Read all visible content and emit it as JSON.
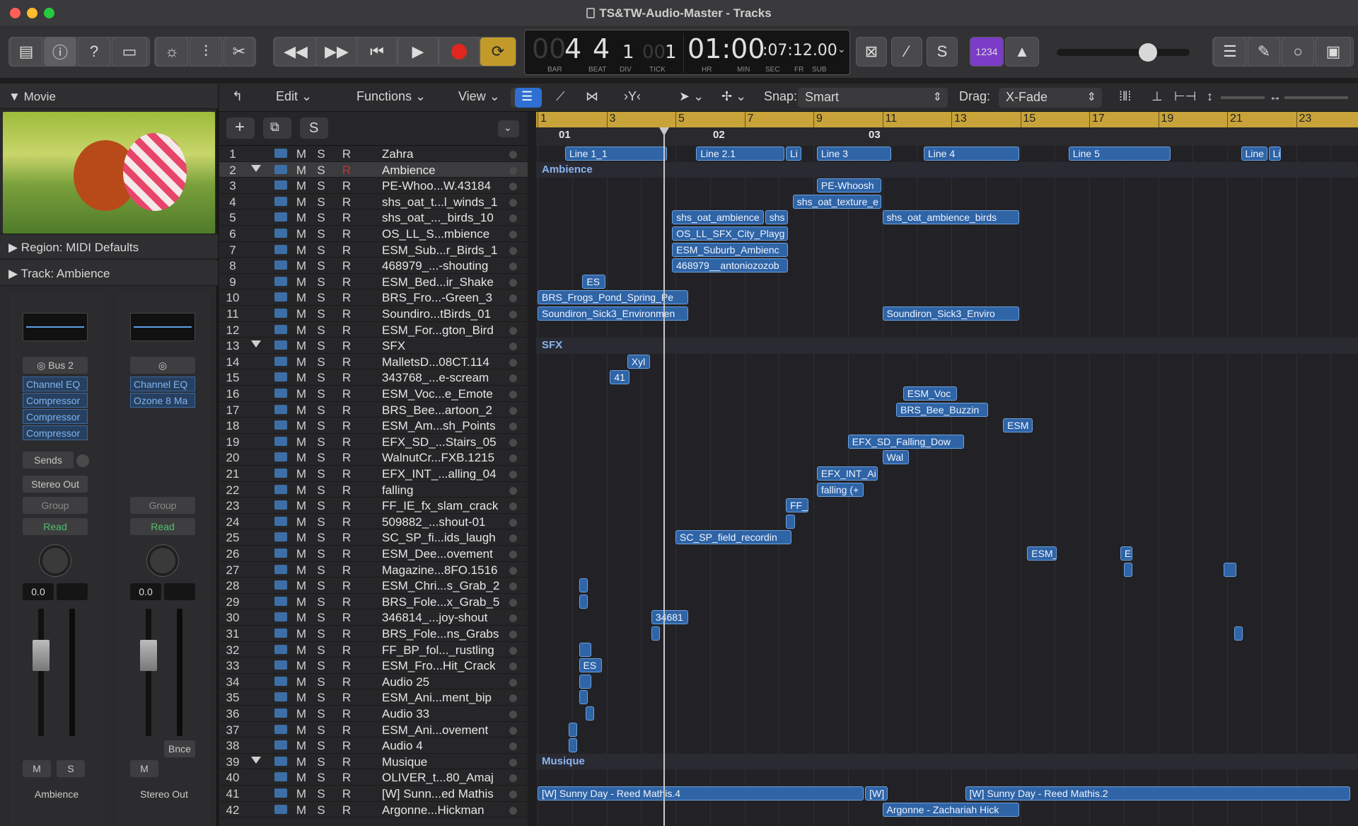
{
  "window": {
    "title": "TS&TW-Audio-Master - Tracks"
  },
  "lcd": {
    "bar": "4",
    "bar_ghost": "00",
    "beat": "4",
    "div": "1",
    "tick": "1",
    "tick_ghost": "00",
    "time_main": "01:00",
    "time_sub": ":07:12.00",
    "labels": [
      "BAR",
      "BEAT",
      "DIV",
      "TICK",
      "HR",
      "MIN",
      "SEC",
      "FR",
      "SUB"
    ]
  },
  "toolbar": {
    "count_in": "1234"
  },
  "inspector": {
    "movie_label": "Movie",
    "region_label": "Region:",
    "region_value": "MIDI Defaults",
    "track_label": "Track:",
    "track_value": "Ambience",
    "strip1": {
      "bus": "Bus 2",
      "plugins": [
        "Channel EQ",
        "Compressor",
        "Compressor",
        "Compressor"
      ],
      "sends": "Sends",
      "output": "Stereo Out",
      "group": "Group",
      "auto": "Read",
      "volume": "0.0",
      "mute": "M",
      "solo": "S",
      "name": "Ambience"
    },
    "strip2": {
      "plugins": [
        "Channel EQ",
        "Ozone 8 Ma"
      ],
      "group": "Group",
      "auto": "Read",
      "volume": "0.0",
      "bounce": "Bnce",
      "mute": "M",
      "name": "Stereo Out"
    },
    "scale": [
      "0",
      "3",
      "6",
      "9",
      "12",
      "15",
      "18",
      "21",
      "24",
      "30",
      "35",
      "40",
      "45",
      "50",
      "60"
    ]
  },
  "localbar": {
    "edit": "Edit",
    "functions": "Functions",
    "view": "View",
    "snap_label": "Snap:",
    "snap_value": "Smart",
    "drag_label": "Drag:",
    "drag_value": "X-Fade"
  },
  "header": {
    "add": "+",
    "s": "S"
  },
  "ruler": {
    "bars": [
      "1",
      "3",
      "5",
      "7",
      "9",
      "11",
      "13",
      "15",
      "17",
      "19",
      "21",
      "23"
    ],
    "markers": [
      "01",
      "02",
      "03"
    ]
  },
  "tracks": [
    {
      "n": "1",
      "name": "Zahra"
    },
    {
      "n": "2",
      "name": "Ambience",
      "folder": true
    },
    {
      "n": "3",
      "name": "PE-Whoo...W.43184"
    },
    {
      "n": "4",
      "name": "shs_oat_t...l_winds_1"
    },
    {
      "n": "5",
      "name": "shs_oat_..._birds_10"
    },
    {
      "n": "6",
      "name": "OS_LL_S...mbience"
    },
    {
      "n": "7",
      "name": "ESM_Sub...r_Birds_1"
    },
    {
      "n": "8",
      "name": "468979_...-shouting"
    },
    {
      "n": "9",
      "name": "ESM_Bed...ir_Shake"
    },
    {
      "n": "10",
      "name": "BRS_Fro...-Green_3"
    },
    {
      "n": "11",
      "name": "Soundiro...tBirds_01"
    },
    {
      "n": "12",
      "name": "ESM_For...gton_Bird"
    },
    {
      "n": "13",
      "name": "SFX",
      "folder": true
    },
    {
      "n": "14",
      "name": "MalletsD...08CT.114"
    },
    {
      "n": "15",
      "name": "343768_...e-scream"
    },
    {
      "n": "16",
      "name": "ESM_Voc...e_Emote"
    },
    {
      "n": "17",
      "name": "BRS_Bee...artoon_2"
    },
    {
      "n": "18",
      "name": "ESM_Am...sh_Points"
    },
    {
      "n": "19",
      "name": "EFX_SD_...Stairs_05"
    },
    {
      "n": "20",
      "name": "WalnutCr...FXB.1215"
    },
    {
      "n": "21",
      "name": "EFX_INT_...alling_04"
    },
    {
      "n": "22",
      "name": "falling"
    },
    {
      "n": "23",
      "name": "FF_IE_fx_slam_crack"
    },
    {
      "n": "24",
      "name": "509882_...shout-01"
    },
    {
      "n": "25",
      "name": "SC_SP_fi...ids_laugh"
    },
    {
      "n": "26",
      "name": "ESM_Dee...ovement"
    },
    {
      "n": "27",
      "name": "Magazine...8FO.1516"
    },
    {
      "n": "28",
      "name": "ESM_Chri...s_Grab_2"
    },
    {
      "n": "29",
      "name": "BRS_Fole...x_Grab_5"
    },
    {
      "n": "30",
      "name": "346814_...joy-shout"
    },
    {
      "n": "31",
      "name": "BRS_Fole...ns_Grabs"
    },
    {
      "n": "32",
      "name": "FF_BP_fol..._rustling"
    },
    {
      "n": "33",
      "name": "ESM_Fro...Hit_Crack"
    },
    {
      "n": "34",
      "name": "Audio 25"
    },
    {
      "n": "35",
      "name": "ESM_Ani...ment_bip"
    },
    {
      "n": "36",
      "name": "Audio 33"
    },
    {
      "n": "37",
      "name": "ESM_Ani...ovement"
    },
    {
      "n": "38",
      "name": "Audio 4"
    },
    {
      "n": "39",
      "name": "Musique",
      "folder": true
    },
    {
      "n": "40",
      "name": "OLIVER_t...80_Amaj"
    },
    {
      "n": "41",
      "name": "[W] Sunn...ed Mathis"
    },
    {
      "n": "42",
      "name": "Argonne...Hickman"
    }
  ],
  "track_buttons": {
    "m": "M",
    "s": "S",
    "r": "R"
  },
  "folders": [
    {
      "row": 1,
      "label": "Ambience"
    },
    {
      "row": 12,
      "label": "SFX"
    },
    {
      "row": 38,
      "label": "Musique"
    }
  ],
  "regions": [
    {
      "row": 0,
      "start": 0.4,
      "end": 1.9,
      "label": "Line 1_1"
    },
    {
      "row": 0,
      "start": 2.3,
      "end": 3.6,
      "label": "Line 2.1"
    },
    {
      "row": 0,
      "start": 3.6,
      "end": 3.85,
      "label": "Li"
    },
    {
      "row": 0,
      "start": 4.05,
      "end": 5.15,
      "label": "Line 3"
    },
    {
      "row": 0,
      "start": 5.6,
      "end": 7.0,
      "label": "Line 4"
    },
    {
      "row": 0,
      "start": 7.7,
      "end": 9.2,
      "label": "Line 5"
    },
    {
      "row": 0,
      "start": 10.2,
      "end": 10.6,
      "label": "Line"
    },
    {
      "row": 0,
      "start": 10.6,
      "end": 10.8,
      "label": "Li"
    },
    {
      "row": 2,
      "start": 4.05,
      "end": 5.0,
      "label": "PE-Whoosh"
    },
    {
      "row": 3,
      "start": 3.7,
      "end": 5.0,
      "label": "shs_oat_texture_e"
    },
    {
      "row": 4,
      "start": 1.95,
      "end": 3.3,
      "label": "shs_oat_ambience"
    },
    {
      "row": 4,
      "start": 3.3,
      "end": 3.65,
      "label": "shs"
    },
    {
      "row": 4,
      "start": 5.0,
      "end": 7.0,
      "label": "shs_oat_ambience_birds"
    },
    {
      "row": 5,
      "start": 1.95,
      "end": 3.65,
      "label": "OS_LL_SFX_City_Playg"
    },
    {
      "row": 6,
      "start": 1.95,
      "end": 3.65,
      "label": "ESM_Suburb_Ambienc"
    },
    {
      "row": 7,
      "start": 1.95,
      "end": 3.65,
      "label": "468979__antoniozozob"
    },
    {
      "row": 8,
      "start": 0.65,
      "end": 1.0,
      "label": "ES"
    },
    {
      "row": 9,
      "start": 0.0,
      "end": 2.2,
      "label": "BRS_Frogs_Pond_Spring_Pe"
    },
    {
      "row": 10,
      "start": 0.0,
      "end": 2.2,
      "label": "Soundiron_Sick3_Environmen"
    },
    {
      "row": 10,
      "start": 5.0,
      "end": 7.0,
      "label": "Soundiron_Sick3_Enviro"
    },
    {
      "row": 13,
      "start": 1.3,
      "end": 1.65,
      "label": "Xyl"
    },
    {
      "row": 14,
      "start": 1.05,
      "end": 1.35,
      "label": "41"
    },
    {
      "row": 15,
      "start": 5.3,
      "end": 6.1,
      "label": "ESM_Voc"
    },
    {
      "row": 16,
      "start": 5.2,
      "end": 6.55,
      "label": "BRS_Bee_Buzzin"
    },
    {
      "row": 17,
      "start": 6.75,
      "end": 7.2,
      "label": "ESM"
    },
    {
      "row": 18,
      "start": 4.5,
      "end": 6.2,
      "label": "EFX_SD_Falling_Dow"
    },
    {
      "row": 19,
      "start": 5.0,
      "end": 5.4,
      "label": "Wal"
    },
    {
      "row": 20,
      "start": 4.05,
      "end": 4.95,
      "label": "EFX_INT_Ai"
    },
    {
      "row": 21,
      "start": 4.05,
      "end": 4.75,
      "label": "falling (+"
    },
    {
      "row": 22,
      "start": 3.6,
      "end": 3.95,
      "label": "FF_"
    },
    {
      "row": 23,
      "start": 3.6,
      "end": 3.75,
      "label": ""
    },
    {
      "row": 24,
      "start": 2.0,
      "end": 3.7,
      "label": "SC_SP_field_recordin"
    },
    {
      "row": 25,
      "start": 7.1,
      "end": 7.55,
      "label": "ESM_"
    },
    {
      "row": 25,
      "start": 8.45,
      "end": 8.65,
      "label": "E"
    },
    {
      "row": 26,
      "start": 8.5,
      "end": 8.65,
      "label": ""
    },
    {
      "row": 26,
      "start": 9.95,
      "end": 10.15,
      "label": ""
    },
    {
      "row": 27,
      "start": 0.6,
      "end": 0.75,
      "label": ""
    },
    {
      "row": 28,
      "start": 0.6,
      "end": 0.7,
      "label": ""
    },
    {
      "row": 29,
      "start": 1.65,
      "end": 2.2,
      "label": "34681"
    },
    {
      "row": 30,
      "start": 1.65,
      "end": 1.75,
      "label": ""
    },
    {
      "row": 30,
      "start": 10.1,
      "end": 10.25,
      "label": ""
    },
    {
      "row": 31,
      "start": 0.6,
      "end": 0.8,
      "label": ""
    },
    {
      "row": 32,
      "start": 0.6,
      "end": 0.95,
      "label": "ES"
    },
    {
      "row": 33,
      "start": 0.6,
      "end": 0.8,
      "label": ""
    },
    {
      "row": 34,
      "start": 0.6,
      "end": 0.75,
      "label": ""
    },
    {
      "row": 35,
      "start": 0.7,
      "end": 0.8,
      "label": ""
    },
    {
      "row": 36,
      "start": 0.45,
      "end": 0.55,
      "label": ""
    },
    {
      "row": 37,
      "start": 0.45,
      "end": 0.55,
      "label": ""
    },
    {
      "row": 40,
      "start": 0.0,
      "end": 4.75,
      "label": "[W] Sunny Day - Reed Mathis.4"
    },
    {
      "row": 40,
      "start": 4.75,
      "end": 5.1,
      "label": "[W]"
    },
    {
      "row": 40,
      "start": 6.2,
      "end": 11.8,
      "label": "[W] Sunny Day - Reed Mathis.2"
    },
    {
      "row": 41,
      "start": 5.0,
      "end": 7.0,
      "label": "Argonne - Zachariah Hick"
    }
  ]
}
